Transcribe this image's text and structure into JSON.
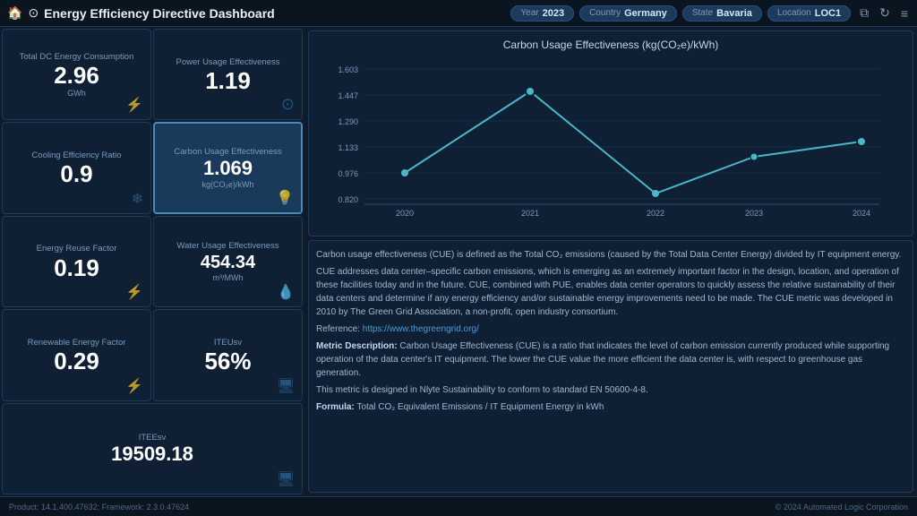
{
  "header": {
    "icon": "⊙",
    "title": "Energy Efficiency Directive Dashboard",
    "year_label": "Year",
    "year_value": "2023",
    "country_label": "Country",
    "country_value": "Germany",
    "state_label": "State",
    "state_value": "Bavaria",
    "location_label": "Location",
    "location_value": "LOC1"
  },
  "metrics": {
    "total_dc_energy": {
      "label": "Total DC Energy Consumption",
      "value": "2.96",
      "unit": "GWh",
      "icon": "⚡"
    },
    "pue": {
      "label": "Power Usage Effectiveness",
      "value": "1.19",
      "unit": "",
      "icon": "⊙"
    },
    "cer": {
      "label": "Cooling Efficiency Ratio",
      "value": "0.9",
      "unit": "",
      "icon": "❄"
    },
    "cue": {
      "label": "Carbon Usage Effectiveness",
      "value": "1.069",
      "unit": "kg(CO₂e)/kWh",
      "icon": "💡",
      "highlighted": true
    },
    "erf": {
      "label": "Energy Reuse Factor",
      "value": "0.19",
      "unit": "",
      "icon": "⚡"
    },
    "wue": {
      "label": "Water Usage Effectiveness",
      "value": "454.34",
      "unit": "m³/MWh",
      "icon": "💧"
    },
    "ref": {
      "label": "Renewable Energy Factor",
      "value": "0.29",
      "unit": "",
      "icon": "⚡"
    },
    "iteusv": {
      "label": "ITEUsv",
      "value": "56%",
      "unit": "",
      "icon": "🖥"
    },
    "iteesv": {
      "label": "ITEEsv",
      "value": "19509.18",
      "unit": "",
      "icon": "🖥"
    }
  },
  "chart": {
    "title": "Carbon Usage Effectiveness (kg(CO₂e)/kWh)",
    "x_labels": [
      "2020",
      "2021",
      "2022",
      "2023",
      "2024"
    ],
    "y_labels": [
      "0.820",
      "0.976",
      "1.133",
      "1.290",
      "1.447",
      "1.603"
    ],
    "data_points": [
      {
        "x": 0,
        "y": 0.976,
        "year": "2020"
      },
      {
        "x": 1,
        "y": 1.47,
        "year": "2021"
      },
      {
        "x": 2,
        "y": 0.855,
        "year": "2022"
      },
      {
        "x": 3,
        "y": 1.075,
        "year": "2023"
      },
      {
        "x": 4,
        "y": 1.165,
        "year": "2024"
      }
    ]
  },
  "info": {
    "description1": "Carbon usage effectiveness (CUE) is defined as the Total CO₂ emissions (caused by the Total Data Center Energy) divided by IT equipment energy.",
    "description2": "CUE addresses data center–specific carbon emissions, which is emerging as an extremely important factor in the design, location, and operation of these facilities today and in the future. CUE, combined with PUE, enables data center operators to quickly assess the relative sustainability of their data centers and determine if any energy efficiency and/or sustainable energy improvements need to be made. The CUE metric was developed in 2010 by The Green Grid Association, a non-profit, open industry consortium.",
    "reference_label": "Reference:",
    "reference_url": "https://www.thegreengrid.org/",
    "metric_desc_label": "Metric Description:",
    "metric_desc": "Carbon Usage Effectiveness (CUE) is a ratio that indicates the level of carbon emission currently produced while supporting operation of the data center's IT equipment. The lower the CUE value the more efficient the data center is, with respect to greenhouse gas generation.",
    "standard": "This metric is designed in Nlyte Sustainability to conform to standard EN 50600-4-8.",
    "formula_label": "Formula:",
    "formula": "Total CO₂ Equivalent Emissions / IT Equipment Energy in kWh"
  },
  "footer": {
    "left": "Product: 14.1.400.47632; Framework: 2.3.0.47624",
    "right": "© 2024 Automated Logic Corporation"
  }
}
